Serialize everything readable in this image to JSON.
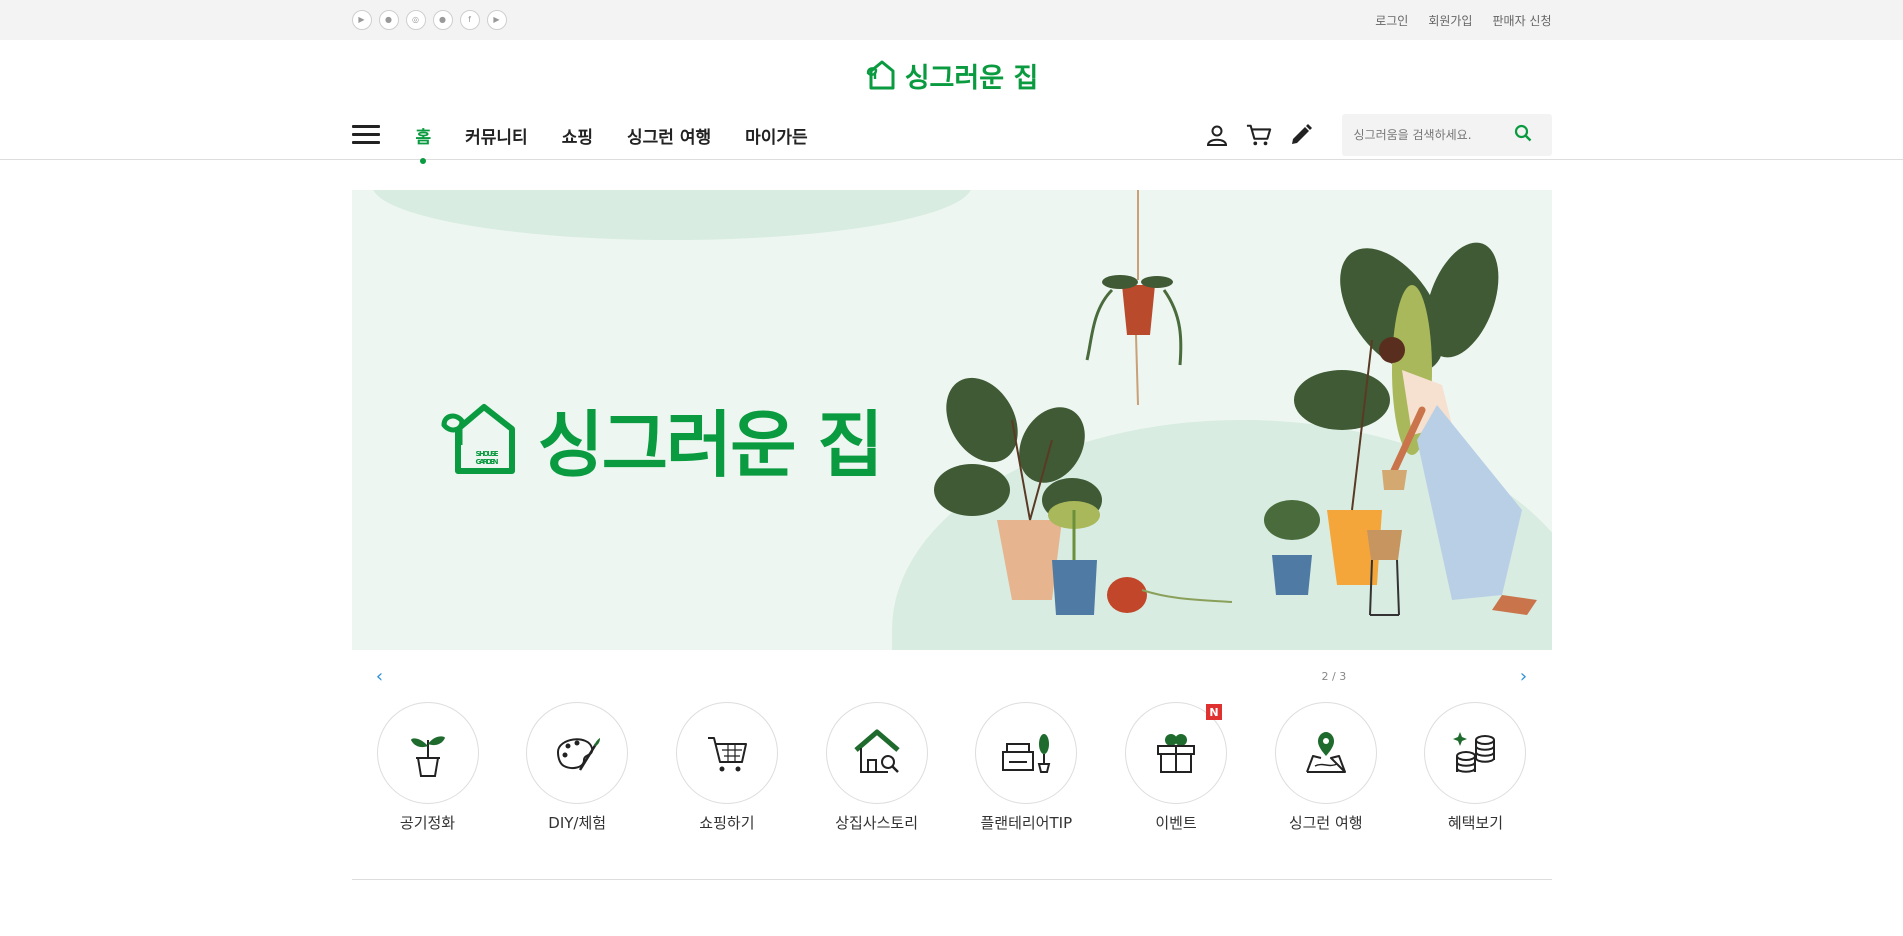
{
  "topbar": {
    "social_icons": [
      "google-play-icon",
      "apple-icon",
      "instagram-icon",
      "kakao-icon",
      "facebook-icon",
      "youtube-icon"
    ],
    "links": {
      "login": "로그인",
      "signup": "회원가입",
      "seller": "판매자 신청"
    }
  },
  "logo": {
    "text": "싱그러운 집"
  },
  "gnb": {
    "menu": [
      "홈",
      "커뮤니티",
      "쇼핑",
      "싱그런 여행",
      "마이가든"
    ],
    "active_index": 0
  },
  "search": {
    "placeholder": "싱그러움을 검색하세요."
  },
  "banner": {
    "logo_text": "싱그러운 집",
    "emblem_line1": "S.HOUSE",
    "emblem_line2": "GARDEN",
    "pager": {
      "current": "2 / 3"
    }
  },
  "quick_menu": [
    {
      "label": "공기정화",
      "icon": "plant-pot-icon"
    },
    {
      "label": "DIY/체험",
      "icon": "palette-icon"
    },
    {
      "label": "쇼핑하기",
      "icon": "cart-icon"
    },
    {
      "label": "상집사스토리",
      "icon": "house-search-icon"
    },
    {
      "label": "플랜테리어TIP",
      "icon": "sofa-plant-icon"
    },
    {
      "label": "이벤트",
      "icon": "gift-icon",
      "badge": "N"
    },
    {
      "label": "싱그런 여행",
      "icon": "map-pin-icon"
    },
    {
      "label": "혜택보기",
      "icon": "coins-icon"
    }
  ],
  "colors": {
    "brand": "#0a9a3f",
    "badge": "#e03131",
    "pager_arrow": "#2a8fd6",
    "topbar_bg": "#f3f3f3",
    "banner_bg": "#edf6f1"
  }
}
